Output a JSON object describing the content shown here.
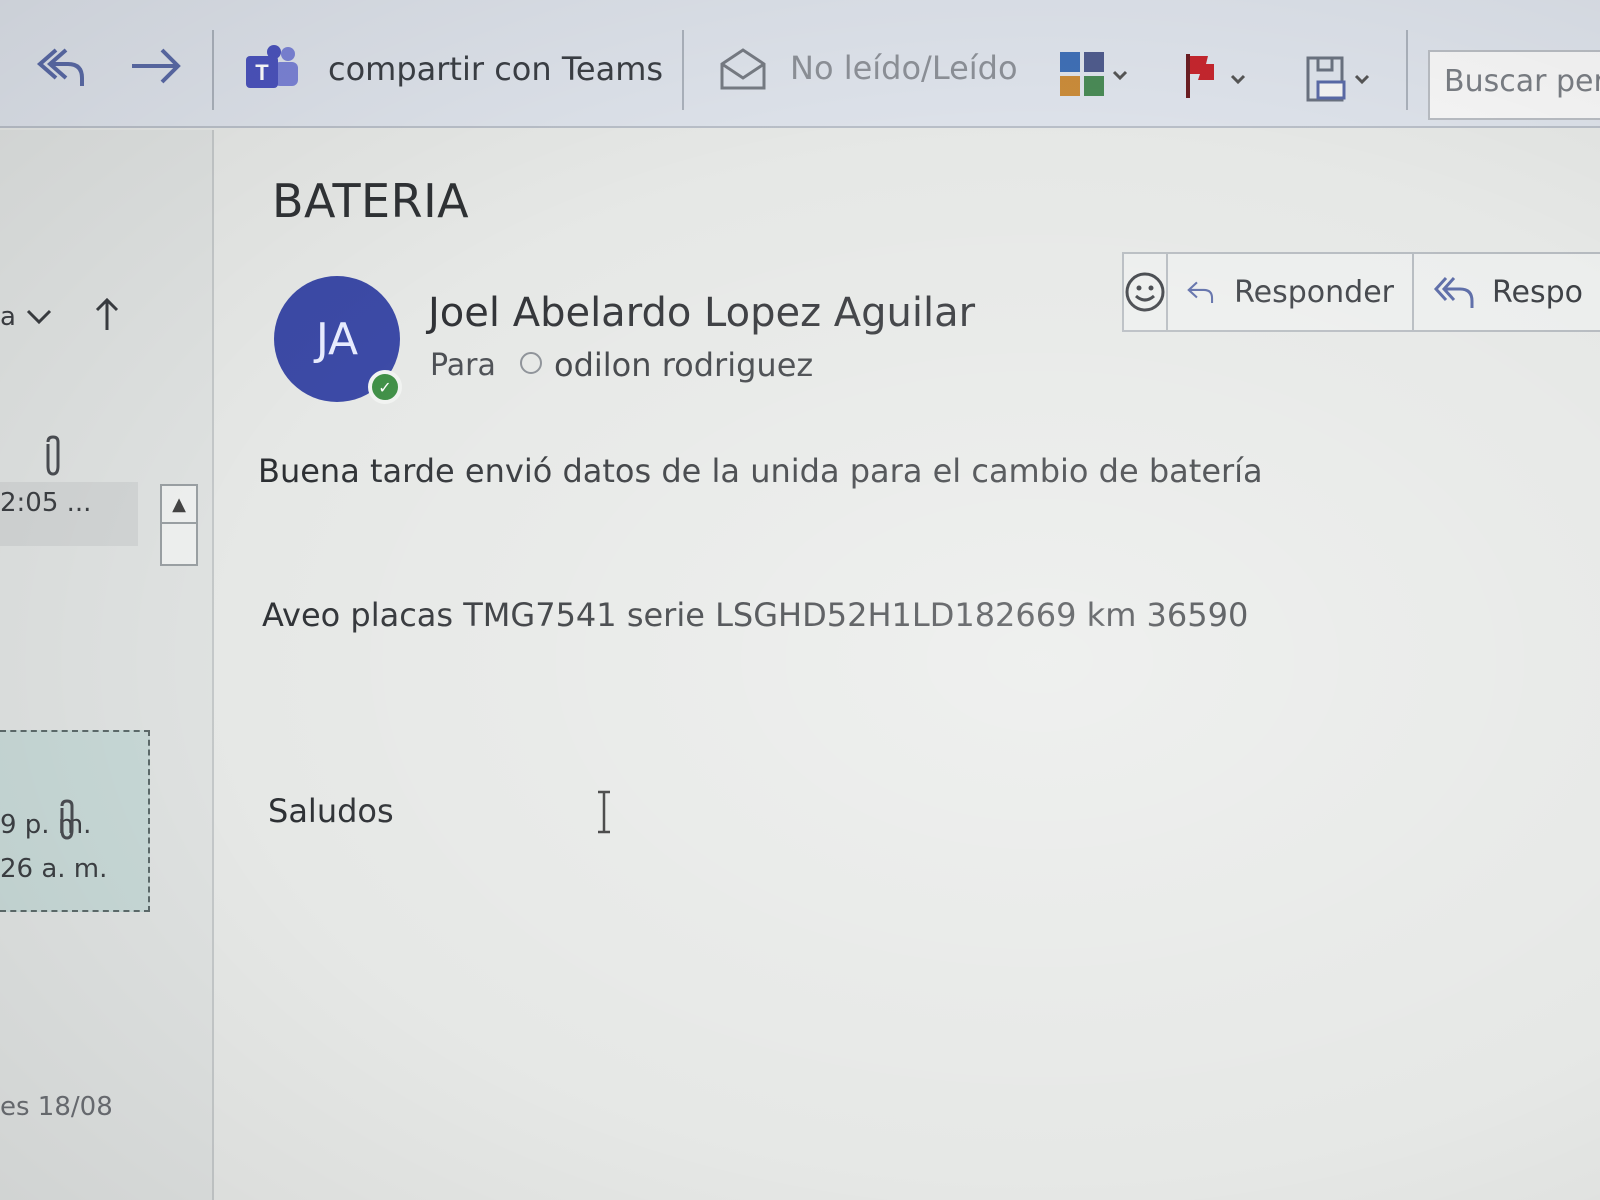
{
  "toolbar": {
    "share_teams_label": "compartir con Teams",
    "unread_read_label": "No leído/Leído",
    "search_placeholder": "Buscar pers"
  },
  "list_pane": {
    "sort_label": "a",
    "items": [
      {
        "time": "2:05 ...",
        "has_attachment": true
      },
      {
        "time": "9 p. m.",
        "selected": true
      },
      {
        "time": "26 a. m.",
        "has_attachment": true
      }
    ],
    "group_footer": "es 18/08"
  },
  "message": {
    "subject": "BATERIA",
    "avatar_initials": "JA",
    "sender": "Joel Abelardo Lopez Aguilar",
    "to_label": "Para",
    "recipient": "odilon rodriguez",
    "actions": {
      "reply_label": "Responder",
      "reply_all_label": "Respo"
    },
    "body": [
      "Buena tarde envió datos de la unida para el cambio de batería",
      "Aveo placas TMG7541 serie LSGHD52H1LD182669 km 36590",
      "Saludos"
    ]
  },
  "colors": {
    "avatar_bg": "#3c4aa6",
    "presence_online": "#3f8f46",
    "teams_purple": "#4b53bc",
    "flag_red": "#c4262e",
    "selected_row": "#c7d8d6"
  },
  "icons": [
    "undo-icon",
    "forward-icon",
    "teams-icon",
    "envelope-open-icon",
    "categorize-icon",
    "flag-icon",
    "move-to-icon",
    "sort-arrow-icon",
    "attachment-icon",
    "emoji-icon",
    "reply-icon",
    "reply-all-icon",
    "text-cursor-icon"
  ]
}
